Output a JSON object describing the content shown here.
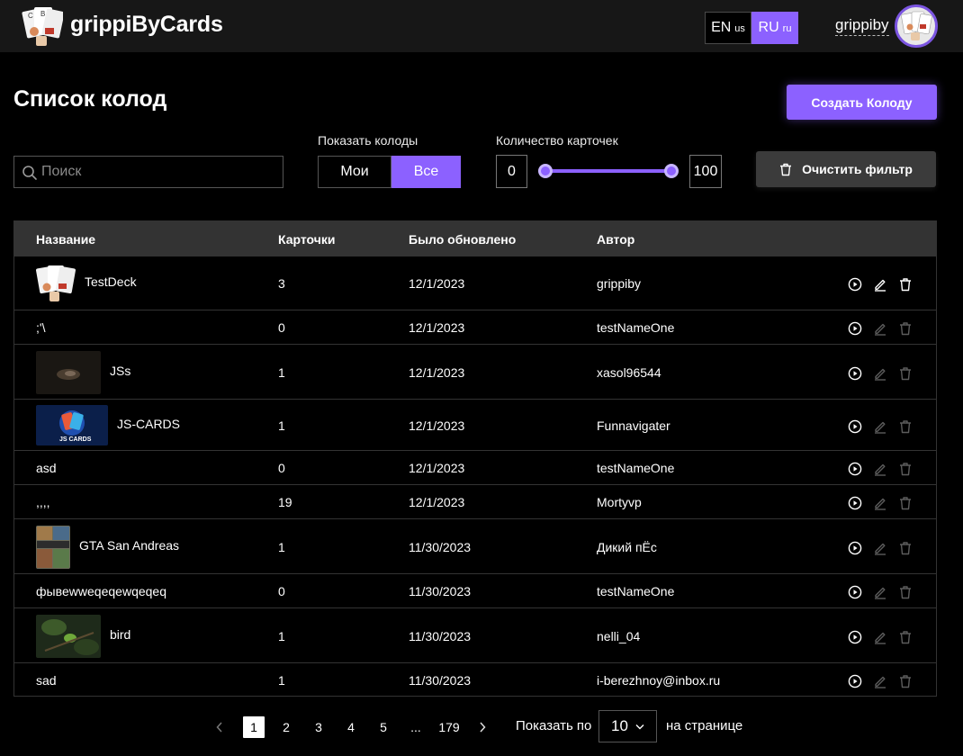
{
  "app": {
    "name": "grippiByCards"
  },
  "header": {
    "lang_en": "EN",
    "lang_en_flag": "us",
    "lang_ru": "RU",
    "lang_ru_flag": "ru",
    "username": "grippiby"
  },
  "page": {
    "title": "Список колод",
    "create_button": "Создать Колоду"
  },
  "filters": {
    "search_placeholder": "Поиск",
    "show_label": "Показать колоды",
    "show_mine": "Мои",
    "show_all": "Все",
    "show_selected": "Все",
    "count_label": "Количество карточек",
    "count_min": "0",
    "count_max": "100",
    "clear_button": "Очистить фильтр"
  },
  "table": {
    "columns": [
      "Название",
      "Карточки",
      "Было обновлено",
      "Автор"
    ],
    "rows": [
      {
        "name": "TestDeck",
        "cards": "3",
        "updated": "12/1/2023",
        "author": "grippiby",
        "thumb": "cards-logo",
        "own": true
      },
      {
        "name": ";'\\",
        "cards": "0",
        "updated": "12/1/2023",
        "author": "testNameOne",
        "thumb": "",
        "own": false
      },
      {
        "name": "JSs",
        "cards": "1",
        "updated": "12/1/2023",
        "author": "xasol96544",
        "thumb": "dark-photo",
        "own": false
      },
      {
        "name": "JS-CARDS",
        "cards": "1",
        "updated": "12/1/2023",
        "author": "Funnavigater",
        "thumb": "js-cards-logo",
        "own": false
      },
      {
        "name": "asd",
        "cards": "0",
        "updated": "12/1/2023",
        "author": "testNameOne",
        "thumb": "",
        "own": false
      },
      {
        "name": ",,,,",
        "cards": "19",
        "updated": "12/1/2023",
        "author": "Mortyvp",
        "thumb": "",
        "own": false
      },
      {
        "name": "GTA San Andreas",
        "cards": "1",
        "updated": "11/30/2023",
        "author": "Дикий пЁс",
        "thumb": "gta-cover",
        "own": false
      },
      {
        "name": "фывewweqeqewqeqeq",
        "cards": "0",
        "updated": "11/30/2023",
        "author": "testNameOne",
        "thumb": "",
        "own": false
      },
      {
        "name": "bird",
        "cards": "1",
        "updated": "11/30/2023",
        "author": "nelli_04",
        "thumb": "bird-photo",
        "own": false
      },
      {
        "name": "sad",
        "cards": "1",
        "updated": "11/30/2023",
        "author": "i-berezhnoy@inbox.ru",
        "thumb": "",
        "own": false
      }
    ]
  },
  "pagination": {
    "pages": [
      "1",
      "2",
      "3",
      "4",
      "5",
      "...",
      "179"
    ],
    "current": "1",
    "show_by_label": "Показать по",
    "per_page": "10",
    "per_page_suffix": "на странице"
  }
}
